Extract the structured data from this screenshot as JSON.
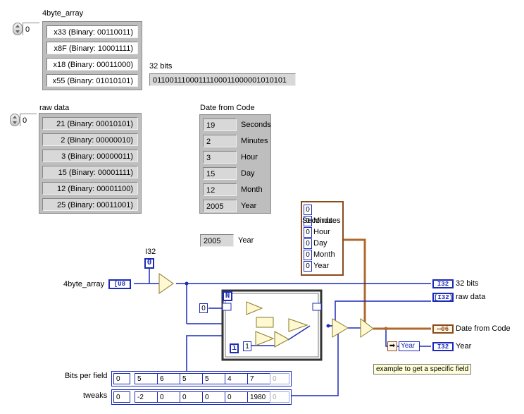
{
  "front_panel": {
    "byte_array": {
      "label": "4byte_array",
      "index": "0",
      "items": [
        "x33 (Binary: 00110011)",
        "x8F (Binary: 10001111)",
        "x18 (Binary: 00011000)",
        "x55 (Binary: 01010101)"
      ]
    },
    "bits32": {
      "label": "32 bits",
      "value": "01100111000111100011000001010101"
    },
    "raw_data": {
      "label": "raw data",
      "index": "0",
      "items": [
        "21 (Binary: 00010101)",
        "2 (Binary: 00000010)",
        "3 (Binary: 00000011)",
        "15 (Binary: 00001111)",
        "12 (Binary: 00001100)",
        "25 (Binary: 00011001)"
      ]
    },
    "date_from_code": {
      "label": "Date from Code",
      "fields": [
        {
          "value": "19",
          "name": "Seconds"
        },
        {
          "value": "2",
          "name": "Minutes"
        },
        {
          "value": "3",
          "name": "Hour"
        },
        {
          "value": "15",
          "name": "Day"
        },
        {
          "value": "12",
          "name": "Month"
        },
        {
          "value": "2005",
          "name": "Year"
        }
      ]
    },
    "year_indicator": {
      "value": "2005",
      "label": "Year"
    }
  },
  "block_diagram": {
    "i32_label": "I32",
    "i32_const": "0",
    "input_label": "4byte_array",
    "u8_term": "[U8",
    "out_32bits_term": "I32",
    "out_32bits_label": "32 bits",
    "out_raw_term": "[I32]",
    "out_raw_label": "raw data",
    "out_date_term": "▭06",
    "out_date_label": "Date from Code",
    "year_select": "Year",
    "out_year_term": "I32",
    "out_year_label": "Year",
    "cluster_const": [
      "Seconds",
      "Minutes",
      "Hour",
      "Day",
      "Month",
      "Year"
    ],
    "cluster_const_val": "0",
    "loop_N": "N",
    "loop_i": "i",
    "loop_const0": "0",
    "loop_const1": "1",
    "bits_per_field": {
      "label": "Bits per field",
      "index": "0",
      "values": [
        "5",
        "6",
        "5",
        "5",
        "4",
        "7",
        "0"
      ]
    },
    "tweaks": {
      "label": "tweaks",
      "index": "0",
      "values": [
        "-2",
        "0",
        "0",
        "0",
        "0",
        "1980",
        "0"
      ]
    },
    "note": "example to get a specific field"
  }
}
